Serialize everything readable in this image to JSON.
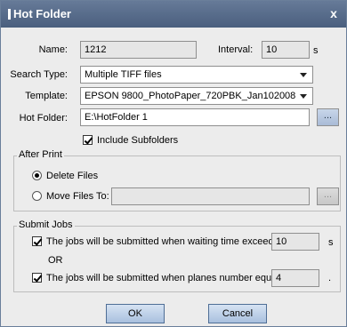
{
  "window": {
    "title": "Hot Folder",
    "close_glyph": "x"
  },
  "form": {
    "name_label": "Name:",
    "name_value": "1212",
    "interval_label": "Interval:",
    "interval_value": "10",
    "interval_unit": "s",
    "search_type_label": "Search Type:",
    "search_type_value": "Multiple TIFF files",
    "template_label": "Template:",
    "template_value": "EPSON 9800_PhotoPaper_720PBK_Jan102008",
    "hot_folder_label": "Hot Folder:",
    "hot_folder_value": "E:\\HotFolder 1",
    "browse_label": "...",
    "include_subfolders_label": "Include Subfolders",
    "include_subfolders_checked": true
  },
  "after_print": {
    "title": "After Print",
    "delete_label": "Delete Files",
    "move_label": "Move Files To:",
    "move_path": "",
    "browse_label": "...",
    "selected": "delete"
  },
  "submit_jobs": {
    "title": "Submit Jobs",
    "waiting_label": "The jobs will be submitted when waiting time exceeds",
    "waiting_value": "10",
    "waiting_unit": "s",
    "or_label": "OR",
    "planes_label": "The jobs will be submitted when planes number equals to",
    "planes_value": "4",
    "planes_unit": "."
  },
  "buttons": {
    "ok": "OK",
    "cancel": "Cancel"
  },
  "colors": {
    "title_bar": "#5a6e8c",
    "button_blue": "#bcd0ea"
  },
  "icons": {
    "close": "close-icon",
    "dropdown": "chevron-down-icon",
    "browse": "ellipsis-icon"
  }
}
